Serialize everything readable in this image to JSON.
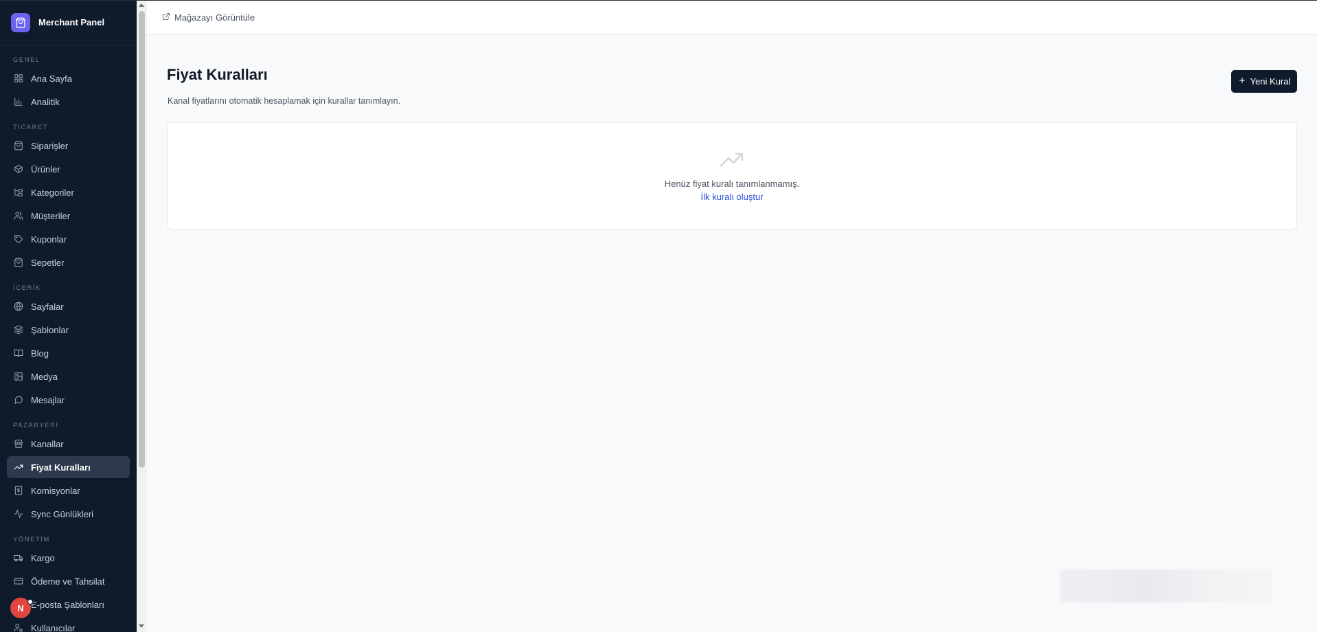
{
  "brand": {
    "name": "Merchant Panel"
  },
  "sidebar": {
    "sections": [
      {
        "label": "GENEL",
        "items": [
          {
            "label": "Ana Sayfa",
            "icon": "grid-icon"
          },
          {
            "label": "Analitik",
            "icon": "bar-chart-icon"
          }
        ]
      },
      {
        "label": "TİCARET",
        "items": [
          {
            "label": "Siparişler",
            "icon": "shopping-bag-icon"
          },
          {
            "label": "Ürünler",
            "icon": "package-icon"
          },
          {
            "label": "Kategoriler",
            "icon": "folder-tree-icon"
          },
          {
            "label": "Müşteriler",
            "icon": "users-icon"
          },
          {
            "label": "Kuponlar",
            "icon": "tag-icon"
          },
          {
            "label": "Sepetler",
            "icon": "cart-icon"
          }
        ]
      },
      {
        "label": "İÇERİK",
        "items": [
          {
            "label": "Sayfalar",
            "icon": "globe-icon"
          },
          {
            "label": "Şablonlar",
            "icon": "layers-icon"
          },
          {
            "label": "Blog",
            "icon": "book-icon"
          },
          {
            "label": "Medya",
            "icon": "image-icon"
          },
          {
            "label": "Mesajlar",
            "icon": "message-icon"
          }
        ]
      },
      {
        "label": "PAZARYERİ",
        "items": [
          {
            "label": "Kanallar",
            "icon": "store-icon"
          },
          {
            "label": "Fiyat Kuralları",
            "icon": "trending-up-icon",
            "active": true
          },
          {
            "label": "Komisyonlar",
            "icon": "receipt-icon"
          },
          {
            "label": "Sync Günlükleri",
            "icon": "activity-icon"
          }
        ]
      },
      {
        "label": "YÖNETİM",
        "items": [
          {
            "label": "Kargo",
            "icon": "truck-icon"
          },
          {
            "label": "Ödeme ve Tahsilat",
            "icon": "credit-card-icon"
          },
          {
            "label": "E-posta Şablonları",
            "icon": "mail-icon"
          },
          {
            "label": "Kullanıcılar",
            "icon": "user-cog-icon"
          }
        ]
      }
    ]
  },
  "avatar": {
    "initial": "N"
  },
  "topbar": {
    "view_store_label": "Mağazayı Görüntüle"
  },
  "page": {
    "title": "Fiyat Kuralları",
    "subtitle": "Kanal fiyatlarını otomatik hesaplamak için kurallar tanımlayın.",
    "new_button_label": "Yeni Kural"
  },
  "empty_state": {
    "icon": "trending-up-icon",
    "message": "Henüz fiyat kuralı tanımlanmamış.",
    "link_label": "İlk kuralı oluştur"
  },
  "colors": {
    "sidebar_bg": "#0f1a2b",
    "active_item_bg": "#2d3a4d",
    "brand_accent": "#6b63f0",
    "link": "#2f53d8",
    "avatar": "#e0463f"
  }
}
